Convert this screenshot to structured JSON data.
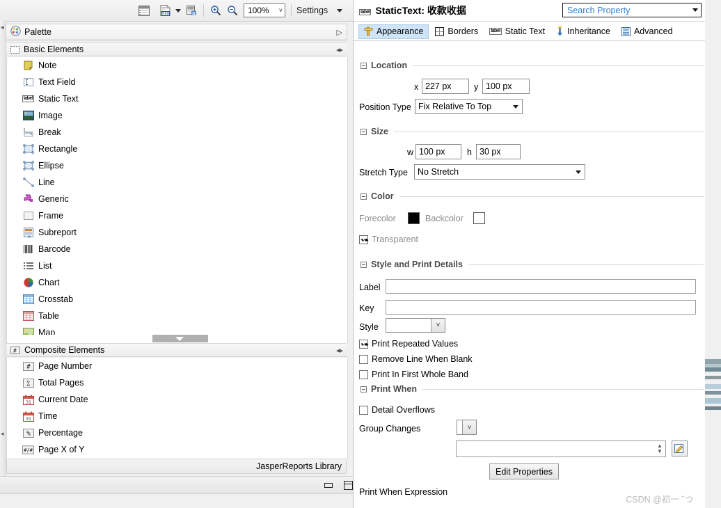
{
  "toolbar": {
    "icons": [
      "report-list-icon",
      "data-source-icon",
      "dropdown-caret-icon",
      "preview-icon",
      "zoom-in-icon",
      "zoom-out-icon"
    ],
    "zoom_value": "100%",
    "settings_label": "Settings"
  },
  "palette": {
    "title": "Palette",
    "expand_icon": "expand-arrow-icon",
    "sections": [
      {
        "name": "Basic Elements",
        "icon": "basic-elements-icon",
        "items": [
          {
            "label": "Note",
            "icon": "note-icon"
          },
          {
            "label": "Text Field",
            "icon": "text-field-icon"
          },
          {
            "label": "Static Text",
            "icon": "static-text-icon"
          },
          {
            "label": "Image",
            "icon": "image-icon"
          },
          {
            "label": "Break",
            "icon": "break-icon"
          },
          {
            "label": "Rectangle",
            "icon": "rectangle-icon"
          },
          {
            "label": "Ellipse",
            "icon": "ellipse-icon"
          },
          {
            "label": "Line",
            "icon": "line-icon"
          },
          {
            "label": "Generic",
            "icon": "generic-icon"
          },
          {
            "label": "Frame",
            "icon": "frame-icon"
          },
          {
            "label": "Subreport",
            "icon": "subreport-icon"
          },
          {
            "label": "Barcode",
            "icon": "barcode-icon"
          },
          {
            "label": "List",
            "icon": "list-icon"
          },
          {
            "label": "Chart",
            "icon": "chart-icon"
          },
          {
            "label": "Crosstab",
            "icon": "crosstab-icon"
          },
          {
            "label": "Table",
            "icon": "table-icon"
          },
          {
            "label": "Map",
            "icon": "map-icon"
          }
        ]
      },
      {
        "name": "Composite Elements",
        "icon": "composite-elements-icon",
        "items": [
          {
            "label": "Page Number",
            "icon": "page-number-icon"
          },
          {
            "label": "Total Pages",
            "icon": "total-pages-icon"
          },
          {
            "label": "Current Date",
            "icon": "current-date-icon"
          },
          {
            "label": "Time",
            "icon": "time-icon"
          },
          {
            "label": "Percentage",
            "icon": "percentage-icon"
          },
          {
            "label": "Page X of Y",
            "icon": "page-x-of-y-icon"
          }
        ]
      }
    ],
    "library_label": "JasperReports Library"
  },
  "properties": {
    "header_icon": "static-text-label-icon",
    "header_title": "StaticText: 收款收据",
    "search_placeholder": "Search Property",
    "tabs": [
      {
        "label": "Appearance",
        "icon": "appearance-icon",
        "active": true
      },
      {
        "label": "Borders",
        "icon": "borders-icon",
        "active": false
      },
      {
        "label": "Static Text",
        "icon": "static-text-icon",
        "active": false
      },
      {
        "label": "Inheritance",
        "icon": "inheritance-icon",
        "active": false
      },
      {
        "label": "Advanced",
        "icon": "advanced-icon",
        "active": false
      }
    ],
    "location": {
      "group_label": "Location",
      "x_label": "x",
      "x_value": "227 px",
      "y_label": "y",
      "y_value": "100 px",
      "position_type_label": "Position Type",
      "position_type_value": "Fix Relative To Top"
    },
    "size": {
      "group_label": "Size",
      "w_label": "w",
      "w_value": "100 px",
      "h_label": "h",
      "h_value": "30 px",
      "stretch_type_label": "Stretch Type",
      "stretch_type_value": "No Stretch"
    },
    "color": {
      "group_label": "Color",
      "forecolor_label": "Forecolor",
      "forecolor_value": "#000000",
      "backcolor_label": "Backcolor",
      "backcolor_value": "#ffffff",
      "transparent_label": "Transparent",
      "transparent_checked": true
    },
    "style_print": {
      "group_label": "Style and Print Details",
      "label_label": "Label",
      "label_value": "",
      "key_label": "Key",
      "key_value": "",
      "style_label": "Style",
      "style_value": "",
      "print_repeated_values": "Print Repeated Values",
      "print_repeated_values_checked": true,
      "remove_line_when_blank": "Remove Line When Blank",
      "remove_line_when_blank_checked": false,
      "print_in_first_whole_band": "Print In First Whole Band",
      "print_in_first_whole_band_checked": false
    },
    "print_when": {
      "group_label": "Print When",
      "detail_overflows": "Detail Overflows",
      "detail_overflows_checked": false,
      "group_changes_label": "Group Changes",
      "group_changes_value": "",
      "print_when_expression_label": "Print When Expression",
      "print_when_expression_value": "",
      "expression_editor_icon": "edit-expression-icon"
    },
    "edit_properties_button": "Edit Properties"
  },
  "window_controls": {
    "minimize_icon": "minimize-icon",
    "maximize_icon": "maximize-icon"
  },
  "watermark": "CSDN @初一 ˘つ"
}
